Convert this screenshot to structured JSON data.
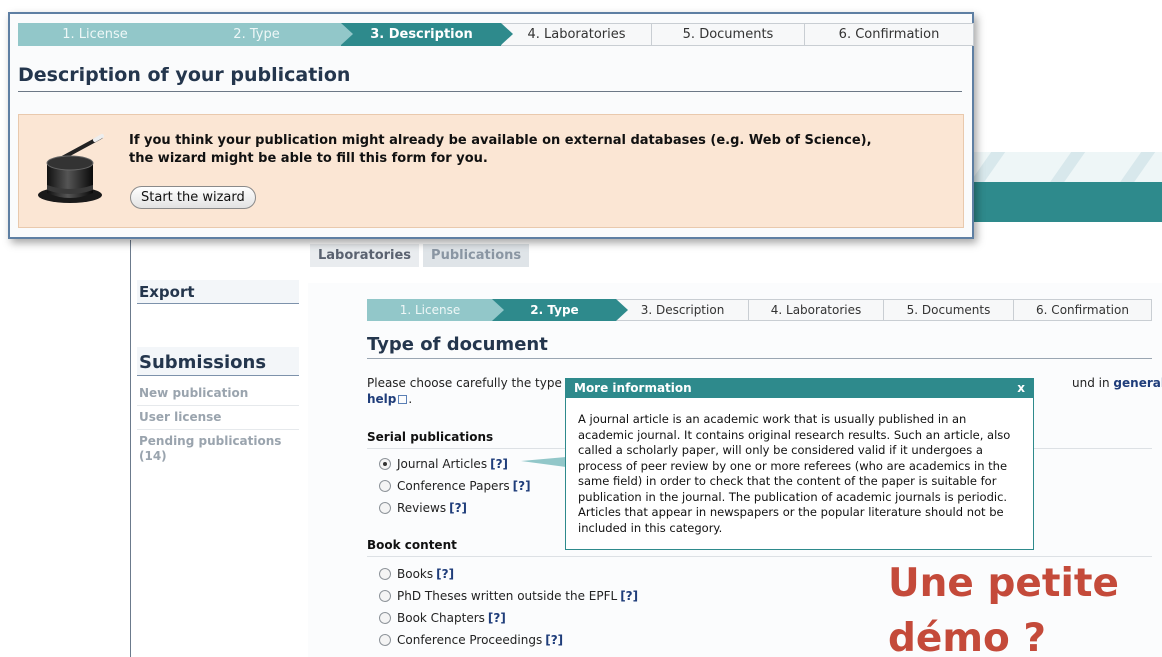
{
  "colors": {
    "teal": "#2e8a8c",
    "teal_light": "#92c7c9",
    "navy": "#24364d",
    "wizard_bg": "#fbe6d4",
    "demo_red": "#c44a3a"
  },
  "foreground": {
    "steps": [
      {
        "label": "1. License",
        "state": "done"
      },
      {
        "label": "2. Type",
        "state": "done"
      },
      {
        "label": "3. Description",
        "state": "current"
      },
      {
        "label": "4. Laboratories",
        "state": "todo"
      },
      {
        "label": "5. Documents",
        "state": "todo"
      },
      {
        "label": "6. Confirmation",
        "state": "todo"
      }
    ],
    "title": "Description of your publication",
    "wizard": {
      "icon": "magic-hat-icon",
      "line1": "If you think your publication might already be available on external databases (e.g. Web of Science),",
      "line2": "the wizard might be able to fill this form for you.",
      "button": "Start the wizard"
    }
  },
  "background": {
    "top_tabs": [
      "Laboratories",
      "Publications"
    ],
    "sidebar": {
      "export_heading": "Export",
      "submissions_heading": "Submissions",
      "items": [
        "New publication",
        "User license",
        "Pending publications (14)"
      ]
    },
    "steps": [
      {
        "label": "1. License",
        "state": "done"
      },
      {
        "label": "2. Type",
        "state": "current"
      },
      {
        "label": "3. Description",
        "state": "todo"
      },
      {
        "label": "4. Laboratories",
        "state": "todo"
      },
      {
        "label": "5. Documents",
        "state": "todo"
      },
      {
        "label": "6. Confirmation",
        "state": "todo"
      }
    ],
    "title": "Type of document",
    "intro": {
      "start": "Please choose carefully the type c",
      "end": "und in",
      "link_general": "general",
      "link_help": "help",
      "suffix": "."
    },
    "serial_heading": "Serial publications",
    "serial_items": [
      {
        "label": "Journal Articles",
        "help": "[?]",
        "checked": true
      },
      {
        "label": "Conference Papers",
        "help": "[?]",
        "checked": false
      },
      {
        "label": "Reviews",
        "help": "[?]",
        "checked": false
      }
    ],
    "book_heading": "Book content",
    "book_items": [
      {
        "label": "Books",
        "help": "[?]",
        "checked": false
      },
      {
        "label": "PhD Theses written outside the EPFL",
        "help": "[?]",
        "checked": false
      },
      {
        "label": "Book Chapters",
        "help": "[?]",
        "checked": false
      },
      {
        "label": "Conference Proceedings",
        "help": "[?]",
        "checked": false
      }
    ],
    "tooltip": {
      "title": "More information",
      "close": "x",
      "lines": [
        "A journal article is an academic work that is usually published in an",
        "academic journal. It contains original research results. Such an article, also",
        "called a scholarly paper, will only be considered valid if it undergoes a",
        "process of peer review by one or more referees (who are academics in the",
        "same field) in order to check that the content of the paper is suitable for",
        "publication in the journal. The publication of academic journals is periodic.",
        "Articles that appear in newspapers or the popular literature should not be",
        "included in this category."
      ]
    }
  },
  "overlay_text": {
    "line1": "Une petite",
    "line2": "démo ?"
  }
}
